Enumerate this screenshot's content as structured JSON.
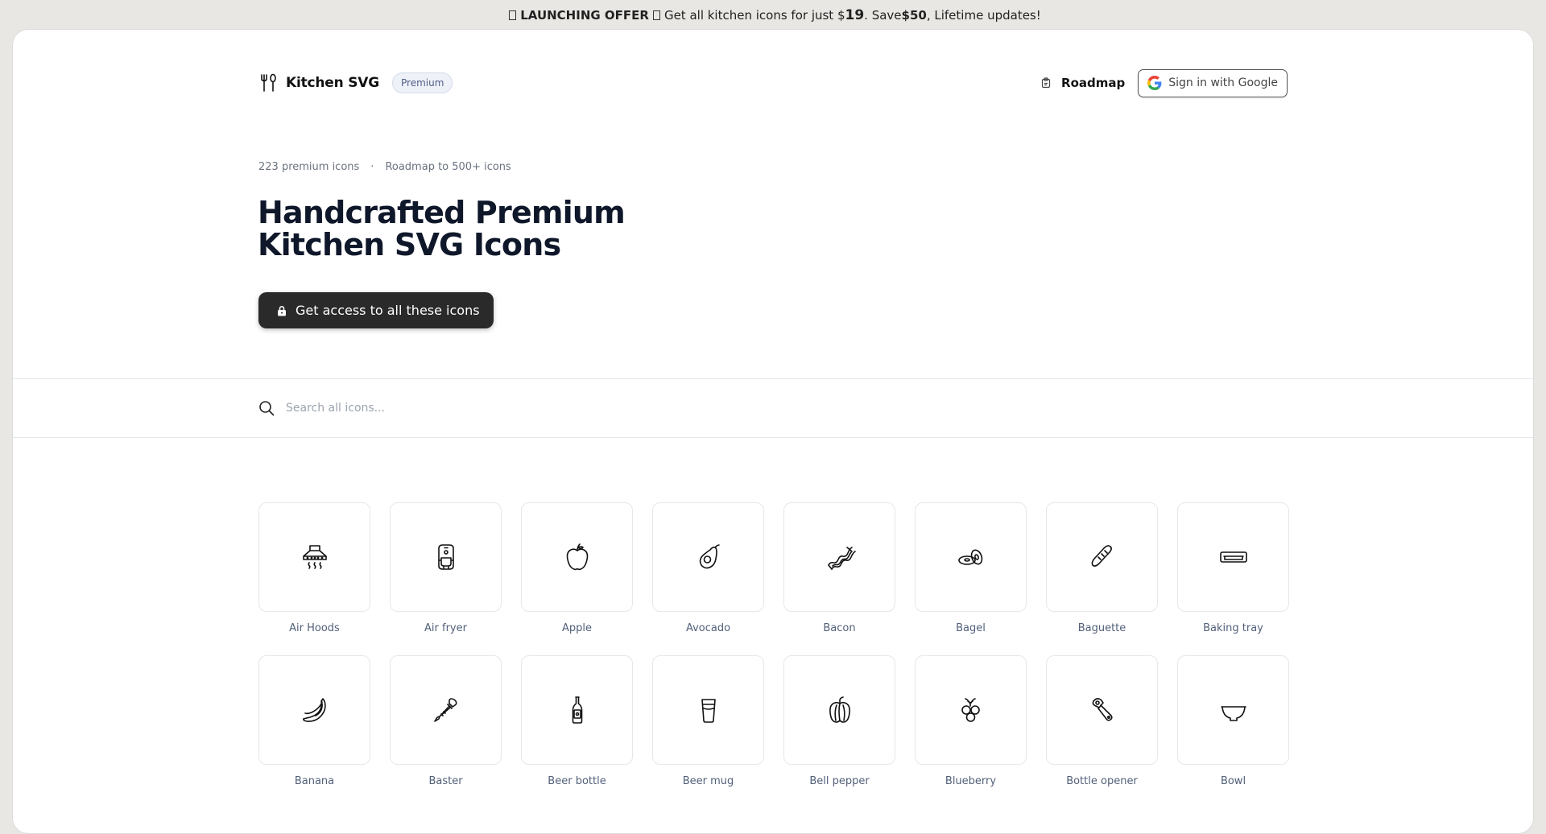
{
  "banner": {
    "prefix": "LAUNCHING OFFER",
    "text1": "Get all kitchen icons for just $",
    "price": "19",
    "text2": ". Save ",
    "save": "$50",
    "text3": ", Lifetime updates!"
  },
  "header": {
    "brand": "Kitchen SVG",
    "badge": "Premium",
    "roadmap": "Roadmap",
    "signin": "Sign in with Google"
  },
  "hero": {
    "count": "223 premium icons",
    "separator": "·",
    "roadmap_note": "Roadmap to 500+ icons",
    "title": "Handcrafted Premium Kitchen SVG Icons",
    "cta": "Get access to all these icons"
  },
  "search": {
    "placeholder": "Search all icons..."
  },
  "icons": [
    {
      "label": "Air Hoods",
      "icon": "hood-icon"
    },
    {
      "label": "Air fryer",
      "icon": "air-fryer-icon"
    },
    {
      "label": "Apple",
      "icon": "apple-icon"
    },
    {
      "label": "Avocado",
      "icon": "avocado-icon"
    },
    {
      "label": "Bacon",
      "icon": "bacon-icon"
    },
    {
      "label": "Bagel",
      "icon": "bagel-icon"
    },
    {
      "label": "Baguette",
      "icon": "baguette-icon"
    },
    {
      "label": "Baking tray",
      "icon": "baking-tray-icon"
    },
    {
      "label": "Banana",
      "icon": "banana-icon"
    },
    {
      "label": "Baster",
      "icon": "baster-icon"
    },
    {
      "label": "Beer bottle",
      "icon": "beer-bottle-icon"
    },
    {
      "label": "Beer mug",
      "icon": "beer-mug-icon"
    },
    {
      "label": "Bell pepper",
      "icon": "bell-pepper-icon"
    },
    {
      "label": "Blueberry",
      "icon": "blueberry-icon"
    },
    {
      "label": "Bottle opener",
      "icon": "bottle-opener-icon"
    },
    {
      "label": "Bowl",
      "icon": "bowl-icon"
    }
  ]
}
